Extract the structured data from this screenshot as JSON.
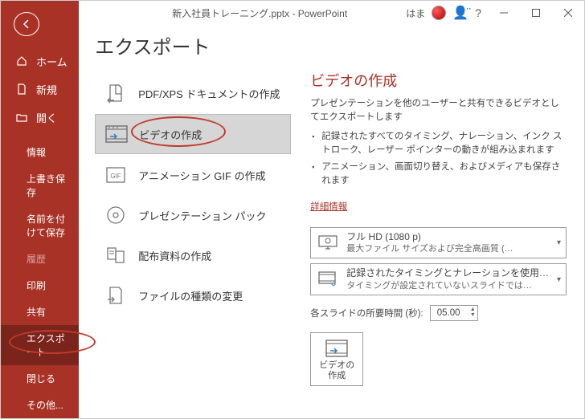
{
  "title": "新入社員トレーニング.pptx  -  PowerPoint",
  "username": "はま",
  "sidebar": {
    "home": "ホーム",
    "new": "新規",
    "open": "開く",
    "info": "情報",
    "save": "上書き保存",
    "saveas": "名前を付けて保存",
    "history": "履歴",
    "print": "印刷",
    "share": "共有",
    "export": "エクスポート",
    "close": "閉じる",
    "other": "その他..."
  },
  "main": {
    "heading": "エクスポート",
    "options": {
      "pdf": "PDF/XPS ドキュメントの作成",
      "video": "ビデオの作成",
      "gif": "アニメーション GIF の作成",
      "pack": "プレゼンテーション パック",
      "handout": "配布資料の作成",
      "filetype": "ファイルの種類の変更"
    }
  },
  "panel": {
    "heading": "ビデオの作成",
    "desc": "プレゼンテーションを他のユーザーと共有できるビデオとしてエクスポートします",
    "bullet1": "記録されたすべてのタイミング、ナレーション、インク ストローク、レーザー ポインターの動きが組み込まれます",
    "bullet2": "アニメーション、画面切り替え、およびメディアも保存されます",
    "link": "詳細情報",
    "quality1": "フル HD (1080 p)",
    "quality2": "最大ファイル サイズおよび完全高画質 (…",
    "timing1": "記録されたタイミングとナレーションを使用…",
    "timing2": "タイミングが設定されていないスライドでは…",
    "durationLabel": "各スライドの所要時間 (秒):",
    "durationValue": "05.00",
    "createBtn": "ビデオの\n作成"
  }
}
